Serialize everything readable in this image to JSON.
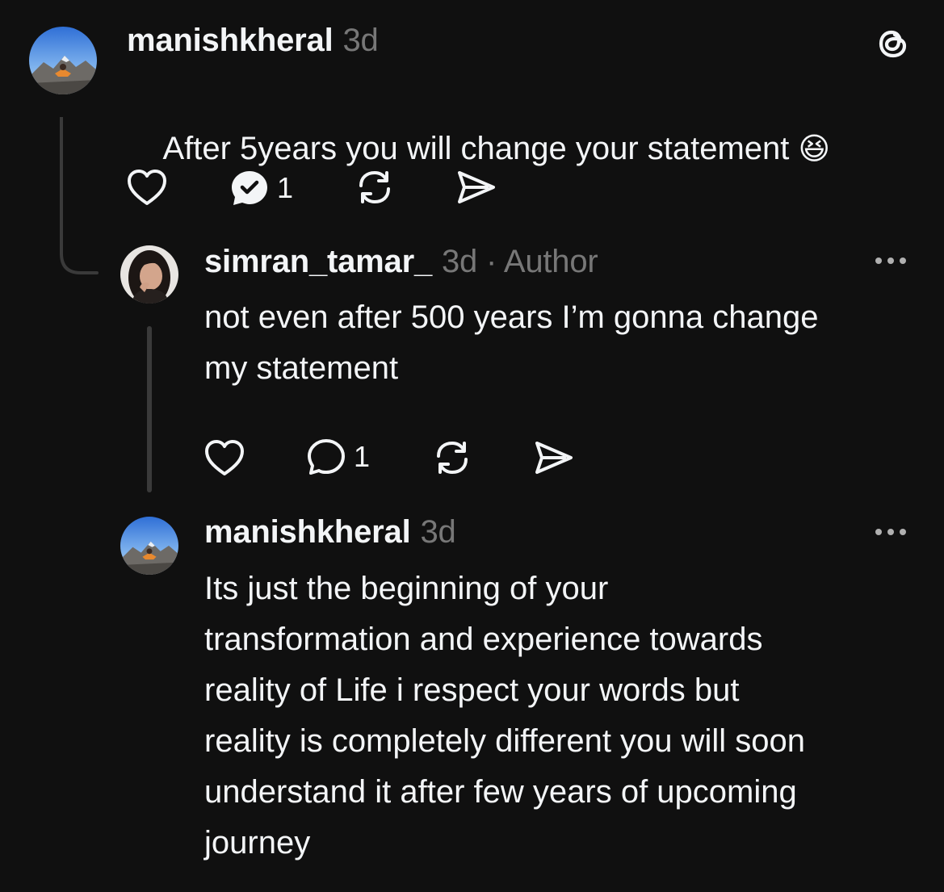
{
  "posts": [
    {
      "username": "manishkheral",
      "time": "3d",
      "text": "After 5years you will change your statement",
      "emoji": "😆",
      "reply_count": "1",
      "avatar_icon": "mountain-avatar"
    },
    {
      "username": "simran_tamar_",
      "time": "3d",
      "author_label": "· Author",
      "text": "not even after 500 years I’m gonna change\nmy statement",
      "reply_count": "1",
      "avatar_icon": "profile-photo-avatar"
    },
    {
      "username": "manishkheral",
      "time": "3d",
      "text": "Its just the beginning of your\ntransformation and experience towards\nreality of Life i respect your words but\nreality is completely different you will soon\nunderstand it after few years of upcoming\njourney",
      "avatar_icon": "mountain-avatar"
    }
  ],
  "header": {
    "logo_icon": "threads-logo-icon"
  },
  "icons": {
    "like": "heart-icon",
    "reply": "comment-icon",
    "repost": "repost-icon",
    "share": "send-icon",
    "more": "more-icon"
  },
  "colors": {
    "background": "#101010",
    "text": "#f3f5f7",
    "muted": "#777777",
    "thread_line": "#3a3a3a"
  }
}
